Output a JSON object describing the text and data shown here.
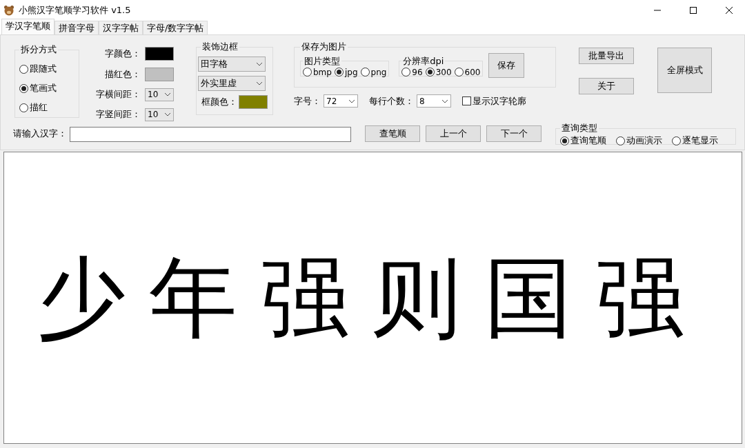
{
  "window": {
    "title": "小熊汉字笔顺学习软件 v1.5"
  },
  "tabs": [
    {
      "label": "学汉字笔顺",
      "selected": true
    },
    {
      "label": "拼音字母",
      "selected": false
    },
    {
      "label": "汉字字帖",
      "selected": false
    },
    {
      "label": "字母/数字字帖",
      "selected": false
    }
  ],
  "split_mode": {
    "title": "拆分方式",
    "options": [
      {
        "label": "跟随式",
        "selected": false
      },
      {
        "label": "笔画式",
        "selected": true
      },
      {
        "label": "描红",
        "selected": false
      }
    ]
  },
  "style_settings": [
    {
      "kind": "swatch",
      "label": "字颜色：",
      "color": "#000000"
    },
    {
      "kind": "swatch",
      "label": "描红色：",
      "color": "#c0c0c0"
    },
    {
      "kind": "combo",
      "label": "字横间距：",
      "value": "10"
    },
    {
      "kind": "combo",
      "label": "字竖间距：",
      "value": "10"
    }
  ],
  "border": {
    "title": "装饰边框",
    "grid_style": "田字格",
    "line_style": "外实里虚",
    "color_label": "框颜色：",
    "color": "#808000"
  },
  "save": {
    "title": "保存为图片",
    "image_type": {
      "title": "图片类型",
      "options": [
        {
          "label": "bmp",
          "selected": false
        },
        {
          "label": "jpg",
          "selected": true
        },
        {
          "label": "png",
          "selected": false
        }
      ]
    },
    "dpi": {
      "title": "分辨率dpi",
      "options": [
        {
          "label": "96",
          "selected": false
        },
        {
          "label": "300",
          "selected": true
        },
        {
          "label": "600",
          "selected": false
        }
      ]
    },
    "button": "保存"
  },
  "font_size": {
    "label": "字号：",
    "value": "72"
  },
  "per_row": {
    "label": "每行个数：",
    "value": "8"
  },
  "outline": {
    "label": "显示汉字轮廓",
    "checked": false
  },
  "side_buttons": [
    "批量导出",
    "关于"
  ],
  "fullscreen_button": "全屏模式",
  "input": {
    "label": "请输入汉字："
  },
  "nav_buttons": [
    "查笔顺",
    "上一个",
    "下一个"
  ],
  "query": {
    "title": "查询类型",
    "options": [
      {
        "label": "查询笔顺",
        "selected": true
      },
      {
        "label": "动画演示",
        "selected": false
      },
      {
        "label": "逐笔显示",
        "selected": false
      }
    ]
  },
  "canvas": {
    "text": "少年强则国强"
  }
}
